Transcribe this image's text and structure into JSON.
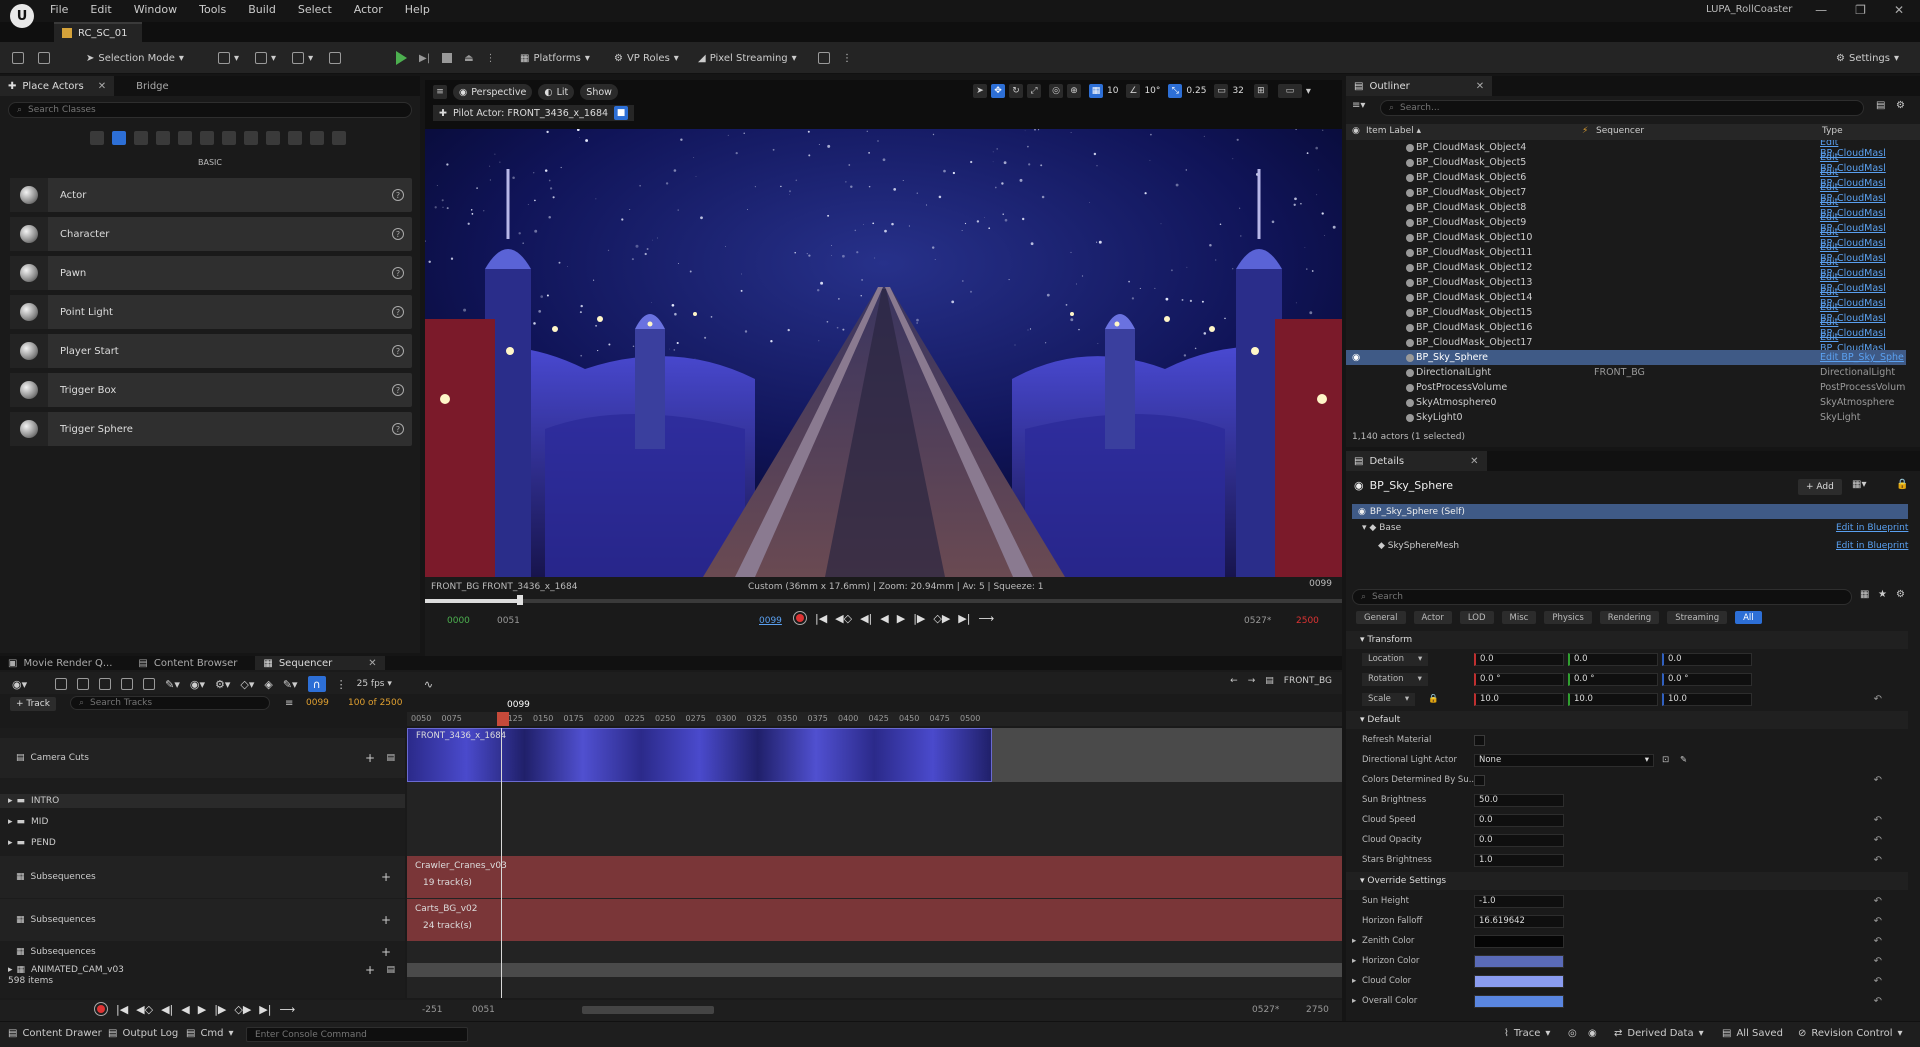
{
  "app": {
    "logo": "U",
    "menus": [
      "File",
      "Edit",
      "Window",
      "Tools",
      "Build",
      "Select",
      "Actor",
      "Help"
    ],
    "project_name": "LUPA_RollCoaster",
    "level_tab": "RC_SC_01",
    "window_controls": [
      "—",
      "❐",
      "✕"
    ]
  },
  "toolbar": {
    "selection_mode": "Selection Mode",
    "platforms": "Platforms",
    "vp_roles": "VP Roles",
    "pixel_streaming": "Pixel Streaming",
    "settings": "Settings"
  },
  "place_actors": {
    "tab": "Place Actors",
    "tab2": "Bridge",
    "search_placeholder": "Search Classes",
    "category_label": "BASIC",
    "items": [
      "Actor",
      "Character",
      "Pawn",
      "Point Light",
      "Player Start",
      "Trigger Box",
      "Trigger Sphere"
    ]
  },
  "viewport": {
    "perspective": "Perspective",
    "lit": "Lit",
    "show": "Show",
    "pilot": "Pilot Actor: FRONT_3436_x_1684",
    "grid_snap": "10",
    "rot_snap": "10°",
    "scale_snap": "0.25",
    "cam_speed": "32",
    "info_left": "FRONT_BG FRONT_3436_x_1684",
    "info_center": "Custom (36mm x 17.6mm) | Zoom: 20.94mm | Av: 5 | Squeeze: 1",
    "info_right": "0099",
    "transport_start": "0000",
    "transport_start2": "0051",
    "transport_current": "0099",
    "transport_end": "0527*",
    "transport_end2": "2500"
  },
  "sequencer": {
    "tabs": [
      "Movie Render Q...",
      "Content Browser",
      "Sequencer"
    ],
    "fps": "25 fps",
    "shot_name": "FRONT_BG",
    "add_track": "+ Track",
    "search_placeholder": "Search Tracks",
    "current_frame": "0099",
    "range_text": "100 of 2500",
    "ruler_ticks": [
      "0050",
      "0075",
      "0099",
      "0125",
      "0150",
      "0175",
      "0200",
      "0225",
      "0250",
      "0275",
      "0300",
      "0325",
      "0350",
      "0375",
      "0400",
      "0425",
      "0450",
      "0475",
      "0500"
    ],
    "tracks": {
      "camera_cuts": "Camera Cuts",
      "intro": "INTRO",
      "mid": "MID",
      "pend": "PEND",
      "subsequences": "Subsequences",
      "animated_cam": "ANIMATED_CAM_v03",
      "items_count": "598 items"
    },
    "shot_clip": "FRONT_3436_x_1684",
    "sub1_name": "Crawler_Cranes_v03",
    "sub1_tracks": "19 track(s)",
    "sub2_name": "Carts_BG_v02",
    "sub2_tracks": "24 track(s)",
    "bottom_left": "-251",
    "bottom_left2": "0051",
    "bottom_right": "0527*",
    "bottom_right2": "2750"
  },
  "outliner": {
    "tab": "Outliner",
    "search_placeholder": "Search...",
    "col_item": "Item Label ▴",
    "col_seq": "Sequencer",
    "col_type": "Type",
    "rows": [
      {
        "name": "BP_CloudMask_Object4",
        "seq": "",
        "type": "Edit BP_CloudMasl"
      },
      {
        "name": "BP_CloudMask_Object5",
        "seq": "",
        "type": "Edit BP_CloudMasl"
      },
      {
        "name": "BP_CloudMask_Object6",
        "seq": "",
        "type": "Edit BP_CloudMasl"
      },
      {
        "name": "BP_CloudMask_Object7",
        "seq": "",
        "type": "Edit BP_CloudMasl"
      },
      {
        "name": "BP_CloudMask_Object8",
        "seq": "",
        "type": "Edit BP_CloudMasl"
      },
      {
        "name": "BP_CloudMask_Object9",
        "seq": "",
        "type": "Edit BP_CloudMasl"
      },
      {
        "name": "BP_CloudMask_Object10",
        "seq": "",
        "type": "Edit BP_CloudMasl"
      },
      {
        "name": "BP_CloudMask_Object11",
        "seq": "",
        "type": "Edit BP_CloudMasl"
      },
      {
        "name": "BP_CloudMask_Object12",
        "seq": "",
        "type": "Edit BP_CloudMasl"
      },
      {
        "name": "BP_CloudMask_Object13",
        "seq": "",
        "type": "Edit BP_CloudMasl"
      },
      {
        "name": "BP_CloudMask_Object14",
        "seq": "",
        "type": "Edit BP_CloudMasl"
      },
      {
        "name": "BP_CloudMask_Object15",
        "seq": "",
        "type": "Edit BP_CloudMasl"
      },
      {
        "name": "BP_CloudMask_Object16",
        "seq": "",
        "type": "Edit BP_CloudMasl"
      },
      {
        "name": "BP_CloudMask_Object17",
        "seq": "",
        "type": "Edit BP_CloudMasl"
      },
      {
        "name": "BP_Sky_Sphere",
        "seq": "",
        "type": "Edit BP_Sky_Sphe"
      },
      {
        "name": "DirectionalLight",
        "seq": "FRONT_BG",
        "type": "DirectionalLight"
      },
      {
        "name": "PostProcessVolume",
        "seq": "",
        "type": "PostProcessVolum"
      },
      {
        "name": "SkyAtmosphere0",
        "seq": "",
        "type": "SkyAtmosphere"
      },
      {
        "name": "SkyLight0",
        "seq": "",
        "type": "SkyLight"
      }
    ],
    "status": "1,140 actors (1 selected)"
  },
  "details": {
    "tab": "Details",
    "object_name": "BP_Sky_Sphere",
    "add": "+ Add",
    "self": "BP_Sky_Sphere (Self)",
    "base": "Base",
    "mesh": "SkySphereMesh",
    "edit_bp": "Edit in Blueprint",
    "search_placeholder": "Search",
    "categories": [
      "General",
      "Actor",
      "LOD",
      "Misc",
      "Physics",
      "Rendering",
      "Streaming",
      "All"
    ],
    "transform": "Transform",
    "location": "Location",
    "rotation": "Rotation",
    "scale": "Scale",
    "loc_vals": [
      "0.0",
      "0.0",
      "0.0"
    ],
    "rot_vals": [
      "0.0 °",
      "0.0 °",
      "0.0 °"
    ],
    "scale_vals": [
      "10.0",
      "10.0",
      "10.0"
    ],
    "default": "Default",
    "props": {
      "refresh": "Refresh Material",
      "dir_light": "Directional Light Actor",
      "dir_light_val": "None",
      "colors_det": "Colors Determined By Su...",
      "sun_brightness": "Sun Brightness",
      "sun_brightness_val": "50.0",
      "cloud_speed": "Cloud Speed",
      "cloud_speed_val": "0.0",
      "cloud_opacity": "Cloud Opacity",
      "cloud_opacity_val": "0.0",
      "stars_brightness": "Stars Brightness",
      "stars_brightness_val": "1.0"
    },
    "override": "Override Settings",
    "over": {
      "sun_height": "Sun Height",
      "sun_height_val": "-1.0",
      "horizon_falloff": "Horizon Falloff",
      "horizon_falloff_val": "16.619642",
      "zenith": "Zenith Color",
      "horizon": "Horizon Color",
      "cloud": "Cloud Color",
      "overall": "Overall Color"
    },
    "colors": {
      "zenith": "#050505",
      "horizon": "#5a6bb8",
      "cloud": "#8a9cf0",
      "overall": "#5a86e0"
    }
  },
  "status": {
    "content_drawer": "Content Drawer",
    "output_log": "Output Log",
    "cmd": "Cmd",
    "console_placeholder": "Enter Console Command",
    "trace": "Trace",
    "derived": "Derived Data",
    "saved": "All Saved",
    "revision": "Revision Control"
  }
}
